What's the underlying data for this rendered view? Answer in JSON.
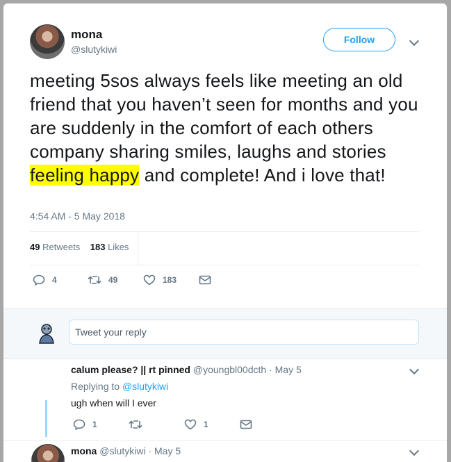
{
  "tweet": {
    "user": {
      "name": "mona",
      "handle": "@slutykiwi"
    },
    "follow_label": "Follow",
    "text_before": "meeting 5sos always feels like meeting an old friend that you haven’t seen for months and you are suddenly in the comfort of each others company sharing smiles, laughs and stories ",
    "text_highlight": "feeling happy",
    "text_after": " and complete! And i love that!",
    "timestamp": "4:54 AM - 5 May 2018",
    "retweets_count": "49",
    "retweets_label": "Retweets",
    "likes_count": "183",
    "likes_label": "Likes",
    "actions": {
      "replies": "4",
      "retweets": "49",
      "likes": "183"
    },
    "highlight_color": "#ffff00",
    "accent_color": "#1da1f2"
  },
  "compose": {
    "placeholder": "Tweet your reply"
  },
  "replies": [
    {
      "name": "calum please? || rt pinned",
      "handle": "@youngbl00dcth",
      "date": "· May 5",
      "replying_prefix": "Replying to",
      "replying_to": "@slutykiwi",
      "text": "ugh when will I ever",
      "actions": {
        "replies": "1",
        "likes": "1"
      }
    },
    {
      "name": "mona",
      "handle": "@slutykiwi",
      "date": "· May 5"
    }
  ]
}
